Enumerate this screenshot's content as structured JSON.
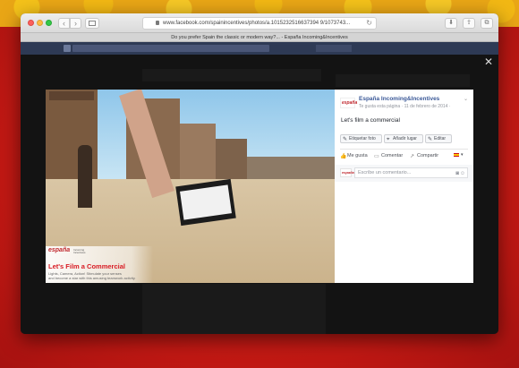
{
  "browser": {
    "url": "www.facebook.com/spainincentives/photos/a.1015232516637394 9/1073743...",
    "tab_title": "Do you prefer Spain the classic or modern way?... - España Incoming&Incentives",
    "back": "‹",
    "forward": "›",
    "reload": "↻",
    "share": "⇪",
    "tabs": "⧉",
    "download": "⬇"
  },
  "viewer": {
    "close": "✕",
    "caption": {
      "logo": "españa",
      "logo_sub": "Incoming\nIncentives",
      "title": "Let's Film a Commercial",
      "line1": "Lights, Camera, Action! Stimulate your senses",
      "line2": "and become a star with this amusing teamwork activity."
    }
  },
  "panel": {
    "page_avatar": "españa",
    "page_name": "España Incoming&Incentives",
    "meta": "Te gusta esta página · 11 de febrero de 2014 · ",
    "post_text": "Let's film a commercial",
    "actions": [
      {
        "icon": "✎",
        "label": "Etiquetar foto"
      },
      {
        "icon": "⌖",
        "label": "Añadir lugar"
      },
      {
        "icon": "✎",
        "label": "Editar"
      }
    ],
    "reactions": [
      {
        "icon": "👍",
        "label": "Me gusta"
      },
      {
        "icon": "▭",
        "label": "Comentar"
      },
      {
        "icon": "↗",
        "label": "Compartir"
      }
    ],
    "comment_placeholder": "Escribe un comentario...",
    "comment_avatar": "españa"
  },
  "colors": {
    "brand": "#3b5998",
    "accent": "#d81c24"
  }
}
